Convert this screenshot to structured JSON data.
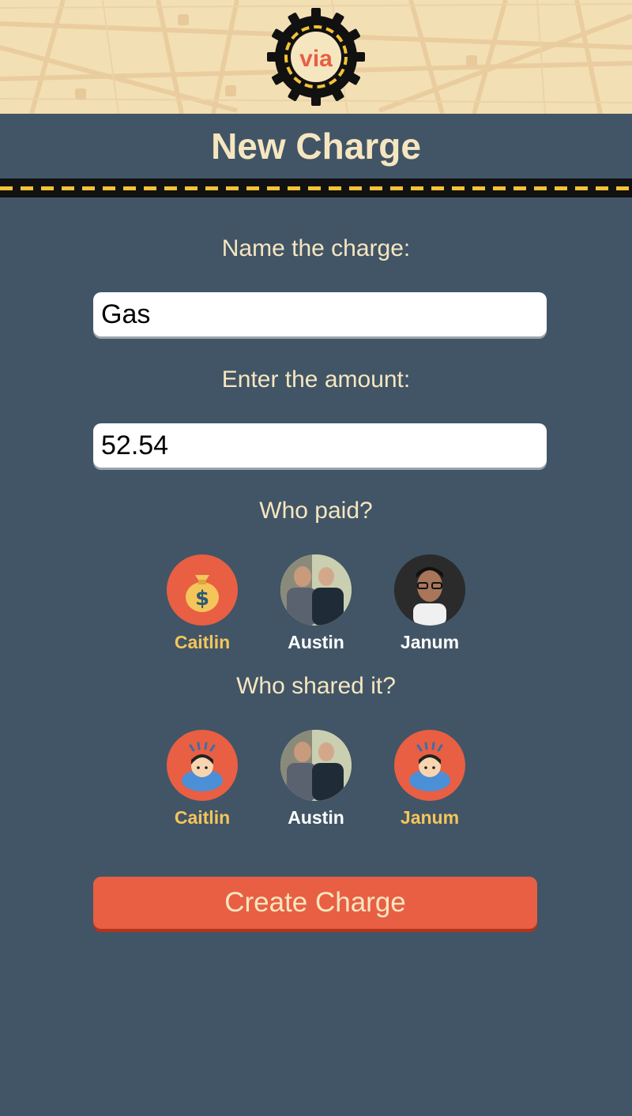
{
  "header": {
    "logo_text": "via",
    "title": "New Charge"
  },
  "form": {
    "name_label": "Name the charge:",
    "name_value": "Gas",
    "amount_label": "Enter the amount:",
    "amount_value": "52.54"
  },
  "paid": {
    "label": "Who paid?",
    "people": [
      {
        "name": "Caitlin",
        "selected": true,
        "icon": "money-bag-icon"
      },
      {
        "name": "Austin",
        "selected": false,
        "icon": "group-photo"
      },
      {
        "name": "Janum",
        "selected": false,
        "icon": "man-photo"
      }
    ]
  },
  "shared": {
    "label": "Who shared it?",
    "people": [
      {
        "name": "Caitlin",
        "selected": true,
        "icon": "person-bowing-icon"
      },
      {
        "name": "Austin",
        "selected": false,
        "icon": "group-photo"
      },
      {
        "name": "Janum",
        "selected": true,
        "icon": "person-bowing-icon"
      }
    ]
  },
  "actions": {
    "create_label": "Create Charge"
  },
  "colors": {
    "background": "#415566",
    "accent": "#e85f43",
    "selected_name": "#f6c55a",
    "title": "#f6e6c0"
  }
}
